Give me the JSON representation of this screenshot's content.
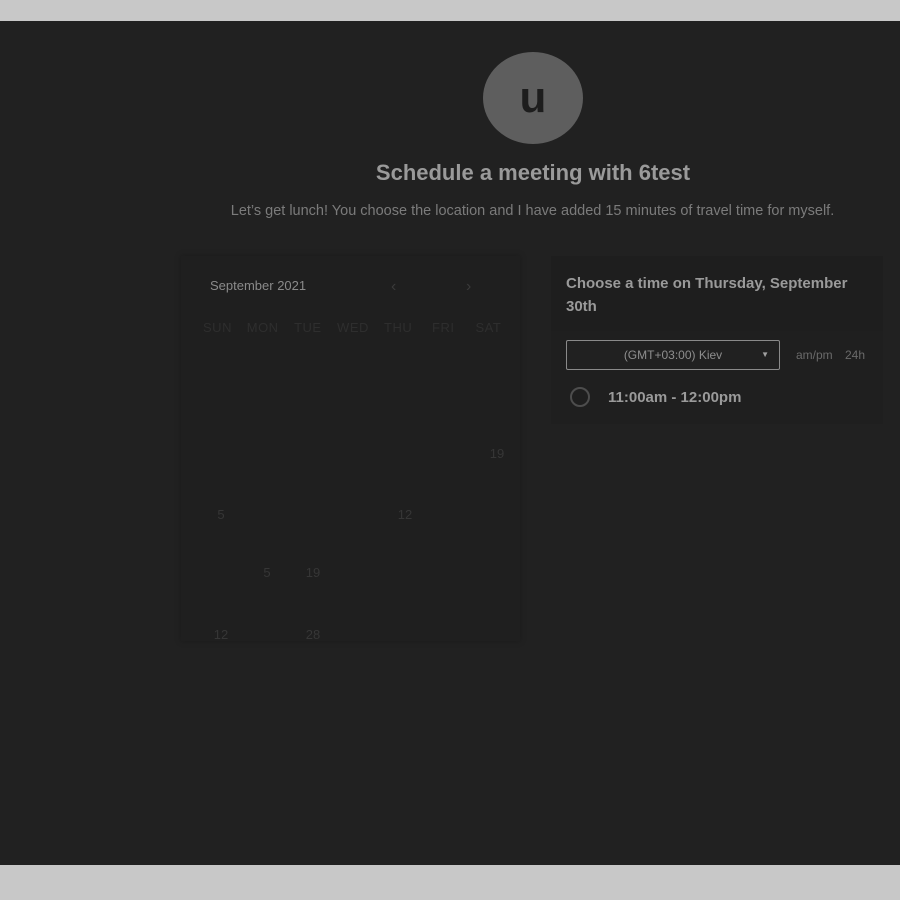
{
  "header": {
    "avatar_letter": "u",
    "title": "Schedule a meeting with 6test",
    "description": "Let’s get lunch! You choose the location and I have added 15 minutes of travel time for myself."
  },
  "calendar": {
    "month_label": "September 2021",
    "prev_icon": "‹",
    "next_icon": "›",
    "weekdays": [
      "SUN",
      "MON",
      "TUE",
      "WED",
      "THU",
      "FRI",
      "SAT"
    ],
    "visible_days": [
      "19",
      "5",
      "12",
      "5",
      "19",
      "12",
      "28"
    ]
  },
  "time_picker": {
    "heading": "Choose a time on Thursday, September 30th",
    "timezone": "(GMT+03:00) Kiev",
    "format_ampm": "am/pm",
    "format_24h": "24h",
    "slots": [
      {
        "label": "11:00am - 12:00pm"
      }
    ]
  },
  "colors": {
    "page_background": "#212121",
    "frame_background": "#c8c8c8"
  }
}
